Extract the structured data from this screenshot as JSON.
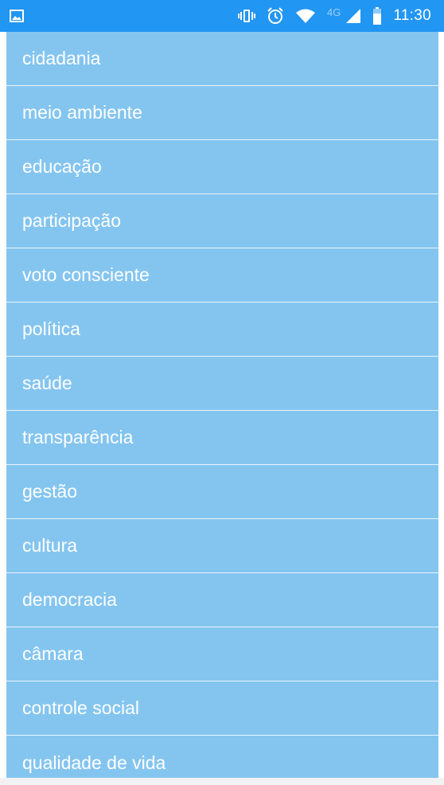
{
  "status_bar": {
    "time": "11:30",
    "network_type": "4G",
    "icons": [
      "image-icon",
      "vibrate-icon",
      "alarm-icon",
      "wifi-icon",
      "signal-icon",
      "battery-icon"
    ]
  },
  "colors": {
    "status_bar": "#2196f3",
    "list_item": "#84c5f0",
    "item_text": "#ffffff"
  },
  "topics": [
    {
      "label": "cidadania"
    },
    {
      "label": "meio ambiente"
    },
    {
      "label": "educação"
    },
    {
      "label": "participação"
    },
    {
      "label": "voto consciente"
    },
    {
      "label": "política"
    },
    {
      "label": "saúde"
    },
    {
      "label": "transparência"
    },
    {
      "label": "gestão"
    },
    {
      "label": "cultura"
    },
    {
      "label": "democracia"
    },
    {
      "label": "câmara"
    },
    {
      "label": "controle social"
    },
    {
      "label": "qualidade de vida"
    }
  ]
}
